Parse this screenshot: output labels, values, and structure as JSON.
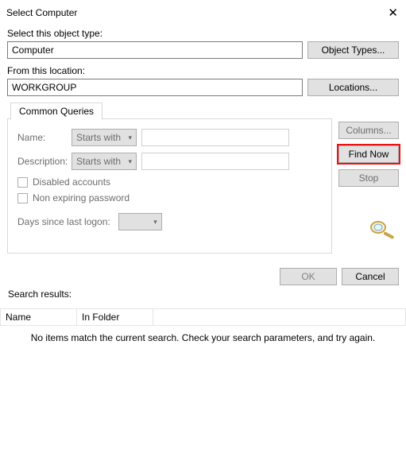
{
  "titlebar": {
    "title": "Select Computer"
  },
  "labels": {
    "object_type": "Select this object type:",
    "from_location": "From this location:",
    "search_results": "Search results:"
  },
  "fields": {
    "object_type_value": "Computer",
    "location_value": "WORKGROUP"
  },
  "buttons": {
    "object_types": "Object Types...",
    "locations": "Locations...",
    "columns": "Columns...",
    "find_now": "Find Now",
    "stop": "Stop",
    "ok": "OK",
    "cancel": "Cancel"
  },
  "tabs": {
    "common_queries": "Common Queries"
  },
  "queries": {
    "name_label": "Name:",
    "description_label": "Description:",
    "starts_with": "Starts with",
    "disabled_accounts": "Disabled accounts",
    "non_expiring": "Non expiring password",
    "days_since": "Days since last logon:"
  },
  "table": {
    "col_name": "Name",
    "col_folder": "In Folder",
    "no_items": "No items match the current search. Check your search parameters, and try again."
  }
}
